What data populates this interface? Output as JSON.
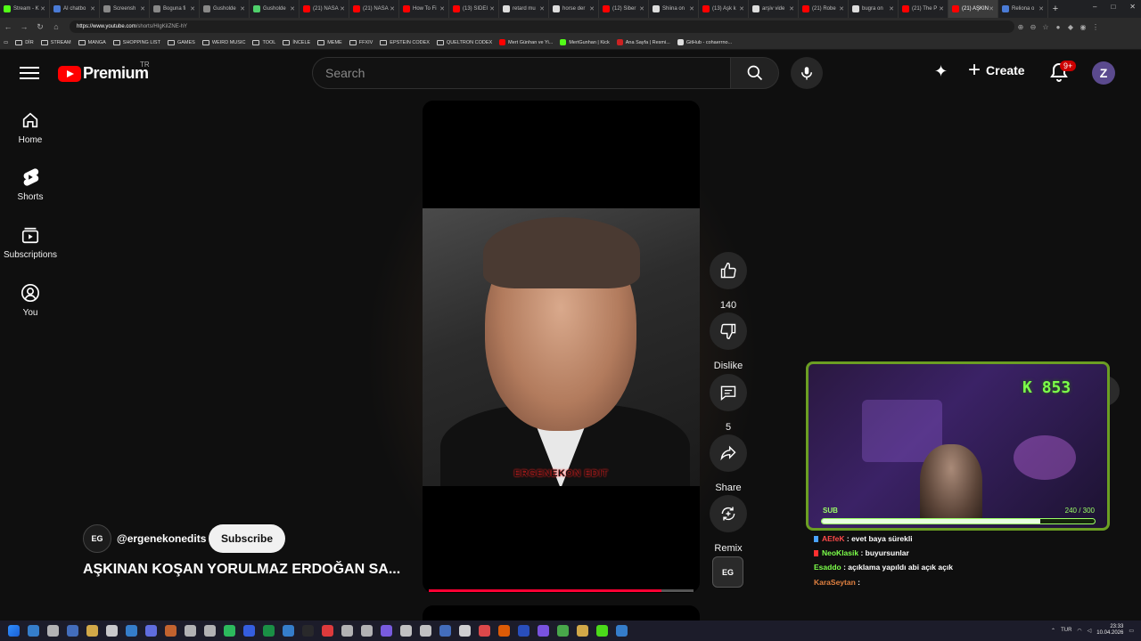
{
  "browser": {
    "tabs": [
      {
        "label": "Stream - K",
        "color": "#53fc18"
      },
      {
        "label": "AI chatbo",
        "color": "#4a7bd6"
      },
      {
        "label": "Screensh",
        "color": "#888888"
      },
      {
        "label": "Boguna fi",
        "color": "#888888"
      },
      {
        "label": "Gusholde",
        "color": "#888888"
      },
      {
        "label": "Gusholde",
        "color": "#4fd06b"
      },
      {
        "label": "(21) NASA",
        "color": "#ff0000"
      },
      {
        "label": "(21) NASA",
        "color": "#ff0000"
      },
      {
        "label": "How To Fi",
        "color": "#ff0000"
      },
      {
        "label": "(13) SIDEI",
        "color": "#ff0000"
      },
      {
        "label": "retard mu",
        "color": "#dddddd"
      },
      {
        "label": "horse der",
        "color": "#dddddd"
      },
      {
        "label": "(12) Siber",
        "color": "#ff0000"
      },
      {
        "label": "Shiina on",
        "color": "#dddddd"
      },
      {
        "label": "(13) Aşk k",
        "color": "#ff0000"
      },
      {
        "label": "arşiv vide",
        "color": "#dddddd"
      },
      {
        "label": "(21) Robe",
        "color": "#ff0000"
      },
      {
        "label": "bugra on",
        "color": "#dddddd"
      },
      {
        "label": "(21) The P",
        "color": "#ff0000"
      },
      {
        "label": "(21) AŞKIN",
        "color": "#ff0000",
        "active": true
      },
      {
        "label": "Reliona o",
        "color": "#4a7bd6"
      }
    ],
    "new_tab": "+",
    "window_controls": [
      "–",
      "□",
      "✕"
    ],
    "url_host": "https://www.youtube.com",
    "url_path": "/shorts/HIgKiIZNE-hY",
    "bookmarks": [
      {
        "label": "DİR",
        "type": "folder"
      },
      {
        "label": "STREAM",
        "type": "folder"
      },
      {
        "label": "MANGA",
        "type": "folder"
      },
      {
        "label": "SHOPPING LIST",
        "type": "folder"
      },
      {
        "label": "GAMES",
        "type": "folder"
      },
      {
        "label": "WEIRD MUSIC",
        "type": "folder"
      },
      {
        "label": "TOOL",
        "type": "folder"
      },
      {
        "label": "İNCELE",
        "type": "folder"
      },
      {
        "label": "MEME",
        "type": "folder"
      },
      {
        "label": "FFXIV",
        "type": "folder"
      },
      {
        "label": "EPSTEIN CODEX",
        "type": "folder"
      },
      {
        "label": "QUELTRON CODEX",
        "type": "folder"
      },
      {
        "label": "Mert Günhan ve Yi...",
        "type": "site",
        "color": "#ff0000"
      },
      {
        "label": "MertGunhan | Kick",
        "type": "site",
        "color": "#53fc18"
      },
      {
        "label": "Ana Sayfa | Resmi...",
        "type": "site",
        "color": "#cc2222"
      },
      {
        "label": "GitHub - cohaerrno...",
        "type": "site",
        "color": "#dddddd"
      }
    ]
  },
  "yt": {
    "logo_text": "Premium",
    "country": "TR",
    "search_placeholder": "Search",
    "create_label": "Create",
    "notification_badge": "9+",
    "avatar_letter": "Z",
    "nav": [
      {
        "label": "Home",
        "icon": "home-icon"
      },
      {
        "label": "Shorts",
        "icon": "shorts-icon"
      },
      {
        "label": "Subscriptions",
        "icon": "subscriptions-icon"
      },
      {
        "label": "You",
        "icon": "you-icon"
      }
    ]
  },
  "short": {
    "watermark": "ERGENEKON EDIT",
    "progress": 0.88,
    "channel_handle": "@ergenekonedits",
    "channel_avatar_text": "EG",
    "subscribe_label": "Subscribe",
    "title": "AŞKINAN KOŞAN YORULMAZ ERDOĞAN SA...",
    "likes": "140",
    "dislike_label": "Dislike",
    "comments": "5",
    "share_label": "Share",
    "remix_label": "Remix",
    "audio_thumb_text": "EG"
  },
  "stream_overlay": {
    "count": "853",
    "sub_label": "SUB",
    "sub_count": "240 / 300",
    "sub_fraction": 0.8,
    "chat": [
      {
        "user": "AEfeK",
        "user_color": "#ff4a4a",
        "badge_color": "#4aa3ff",
        "message": ": evet baya sürekli"
      },
      {
        "user": "NeoKlasik",
        "user_color": "#7cff4a",
        "badge_color": "#ff3030",
        "message": ": buyursunlar"
      },
      {
        "user": "Esaddo",
        "user_color": "#7cff4a",
        "badge_color": "",
        "message": ": açıklama yapıldı abi açık açık"
      },
      {
        "user": "KaraSeytan",
        "user_color": "#e08040",
        "badge_color": "",
        "message": ":"
      }
    ]
  },
  "taskbar": {
    "icons": [
      "#3a8ee6",
      "#cccccc",
      "#4a7bd6",
      "#f2c14e",
      "#e8e8e8",
      "#3a8ee6",
      "#6c7bff",
      "#e07030",
      "#cccccc",
      "#cccccc",
      "#2fd566",
      "#3a6aff",
      "#1aa34a",
      "#3a8ee6",
      "#2b2b2b",
      "#ff4040",
      "#cccccc",
      "#cccccc",
      "#8866ff",
      "#dddddd",
      "#dddddd",
      "#4a7bd6",
      "#eeeeee",
      "#ff5050",
      "#ff6600",
      "#2b57d6",
      "#8a5cff",
      "#50c050",
      "#f2c14e",
      "#53fc18",
      "#3a8ee6"
    ],
    "lang": "TUR",
    "time": "23:33",
    "date": "10.04.2026"
  },
  "colors": {
    "accent_red": "#ff0000",
    "progress_red": "#ff0033",
    "stream_green": "#7cff4a"
  }
}
